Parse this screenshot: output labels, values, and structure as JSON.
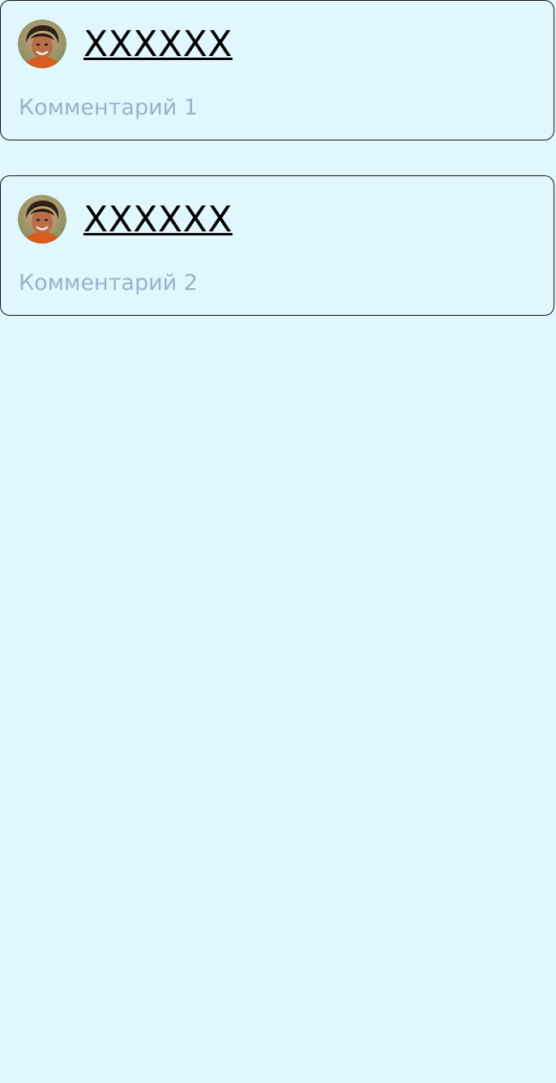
{
  "comments": [
    {
      "author": "XXXXXX",
      "text": "Комментарий 1",
      "avatar_icon": "user-avatar"
    },
    {
      "author": "XXXXXX",
      "text": "Комментарий 2",
      "avatar_icon": "user-avatar"
    }
  ],
  "colors": {
    "background": "#e0f7fe",
    "card_border": "#111111",
    "comment_text": "#9cb0c8",
    "author_text": "#000000"
  }
}
